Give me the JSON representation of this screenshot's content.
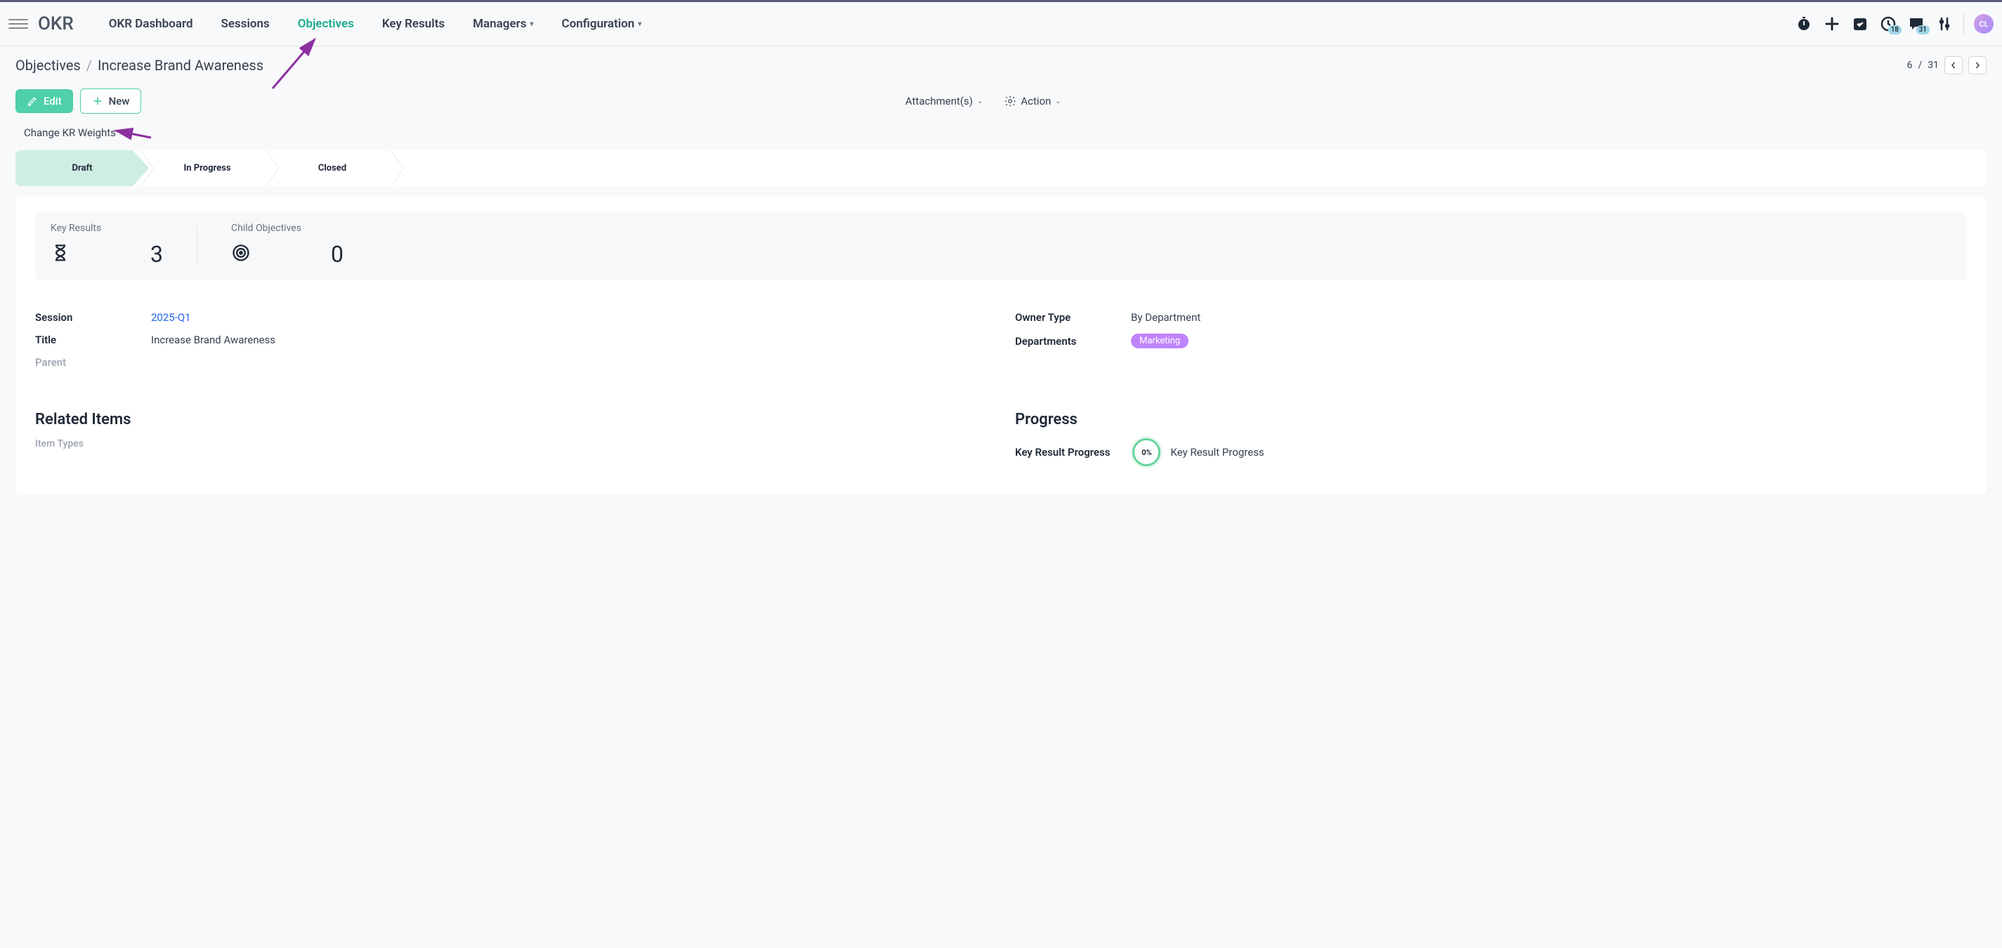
{
  "brand": "OKR",
  "nav": {
    "dashboard": "OKR Dashboard",
    "sessions": "Sessions",
    "objectives": "Objectives",
    "keyresults": "Key Results",
    "managers": "Managers",
    "configuration": "Configuration"
  },
  "active_nav": "objectives",
  "topbar": {
    "clock_badge": "18",
    "message_badge": "31",
    "avatar": "CL"
  },
  "breadcrumb": {
    "parent": "Objectives",
    "current": "Increase Brand Awareness"
  },
  "pager": {
    "current": "6",
    "total": "31",
    "sep": " / "
  },
  "buttons": {
    "edit": "Edit",
    "new": "New"
  },
  "controls": {
    "attachments": "Attachment(s)",
    "action": "Action"
  },
  "kr_link": "Change KR Weights",
  "status": {
    "draft": "Draft",
    "in_progress": "In Progress",
    "closed": "Closed"
  },
  "stats": {
    "key_results_label": "Key Results",
    "key_results_value": "3",
    "child_objectives_label": "Child Objectives",
    "child_objectives_value": "0"
  },
  "fields": {
    "session_label": "Session",
    "session_value": "2025-Q1",
    "title_label": "Title",
    "title_value": "Increase Brand Awareness",
    "parent_label": "Parent",
    "owner_type_label": "Owner Type",
    "owner_type_value": "By Department",
    "departments_label": "Departments",
    "departments_value": "Marketing"
  },
  "sections": {
    "related_title": "Related Items",
    "item_types_label": "Item Types",
    "progress_title": "Progress",
    "kr_progress_label": "Key Result Progress",
    "kr_progress_pct": "0%",
    "kr_progress_label2": "Key Result Progress"
  }
}
